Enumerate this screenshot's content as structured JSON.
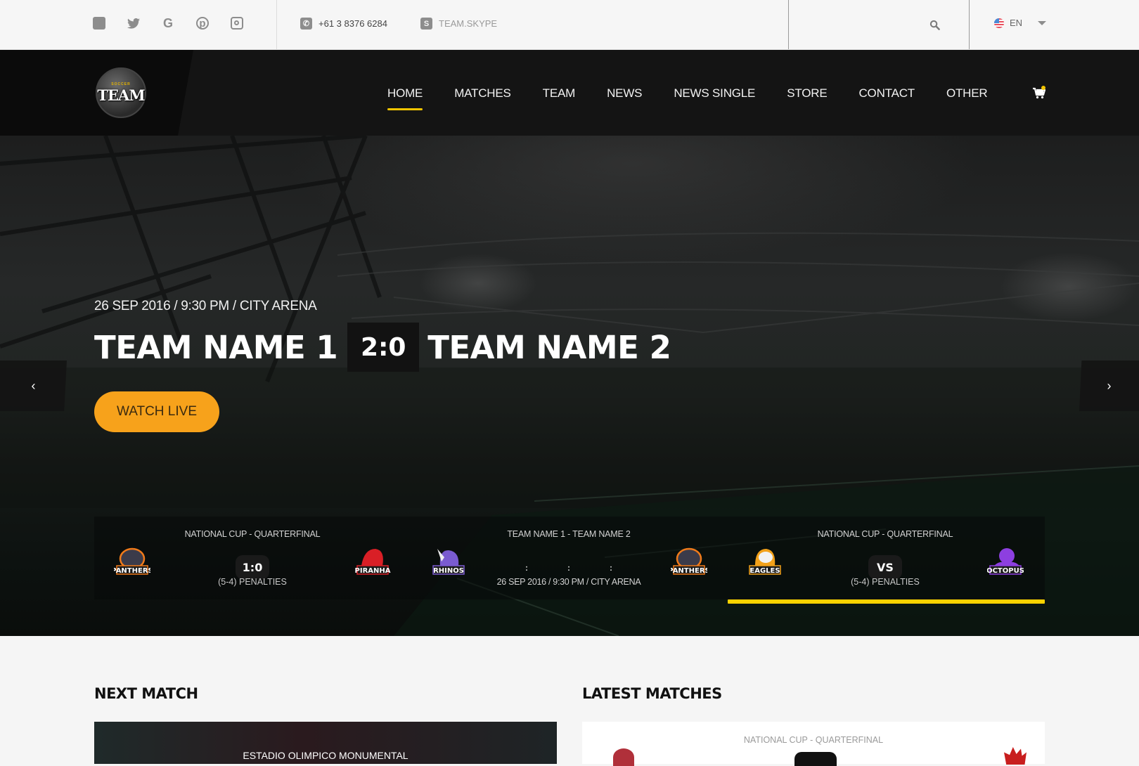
{
  "topbar": {
    "social": [
      {
        "icon": "facebook-icon",
        "glyph": "f"
      },
      {
        "icon": "twitter-icon",
        "glyph": "🐦"
      },
      {
        "icon": "google-icon",
        "glyph": "G"
      },
      {
        "icon": "pinterest-icon",
        "glyph": "p"
      },
      {
        "icon": "instagram-icon",
        "glyph": ""
      }
    ],
    "phone": "+61 3 8376 6284",
    "skype": "TEAM.SKYPE",
    "language": "EN"
  },
  "header": {
    "logo_sub": "SOCCER",
    "logo_main": "TEAM",
    "nav": [
      {
        "label": "HOME",
        "active": true
      },
      {
        "label": "MATCHES"
      },
      {
        "label": "TEAM"
      },
      {
        "label": "NEWS"
      },
      {
        "label": "NEWS SINGLE"
      },
      {
        "label": "STORE"
      },
      {
        "label": "CONTACT"
      },
      {
        "label": "OTHER"
      }
    ]
  },
  "hero": {
    "date_line": "26 SEP 2016 / 9:30 PM / CITY ARENA",
    "team1": "TEAM NAME 1",
    "score": "2:0",
    "team2": "TEAM NAME 2",
    "cta": "WATCH LIVE",
    "prev_arrow": "‹",
    "next_arrow": "›"
  },
  "match_strip": [
    {
      "competition": "NATIONAL CUP - QUARTERFINAL",
      "home": "PANTHERS",
      "away": "PIRANHA",
      "score": "1:0",
      "note": "(5-4) PENALTIES"
    },
    {
      "competition": "TEAM NAME 1 - TEAM NAME 2",
      "home": "RHINOS",
      "away": "PANTHERS",
      "countdown": [
        ":",
        ":",
        ":"
      ],
      "when": "26 SEP 2016 / 9:30 PM / CITY ARENA"
    },
    {
      "competition": "NATIONAL CUP - QUARTERFINAL",
      "home": "EAGLES",
      "away": "OCTOPUS",
      "score": "VS",
      "note": "(5-4) PENALTIES"
    }
  ],
  "slider_progress": 1.0,
  "sections": {
    "next_match_title": "NEXT MATCH",
    "next_match_venue": "ESTADIO OLIMPICO MONUMENTAL",
    "latest_matches_title": "LATEST MATCHES",
    "latest_competition": "NATIONAL CUP - QUARTERFINAL"
  },
  "colors": {
    "accent_yellow": "#f2c400",
    "cta_orange": "#f7a21b",
    "nav_bg": "#141414",
    "panthers": "#f07a1a",
    "piranha": "#d91f26",
    "rhinos": "#7a5bd0",
    "eagles": "#f2a11a",
    "octopus": "#8d3fe0"
  }
}
